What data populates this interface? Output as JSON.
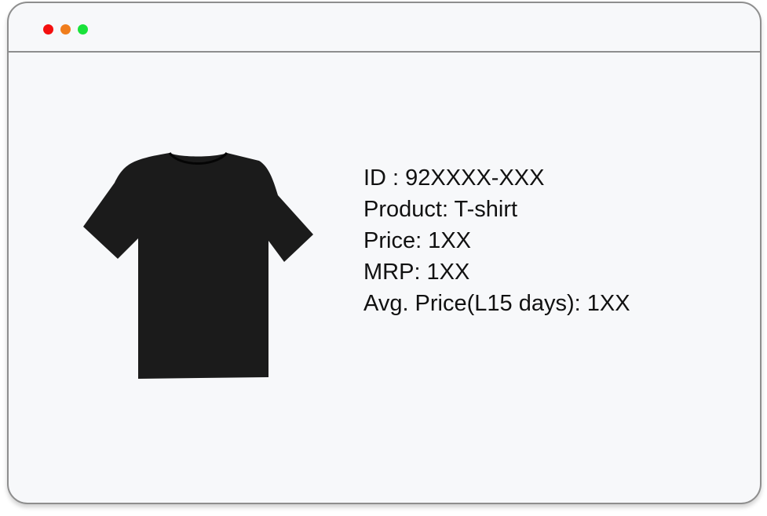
{
  "window": {
    "controls": [
      {
        "name": "close",
        "color": "#f40f0f"
      },
      {
        "name": "minimize",
        "color": "#f07d1c"
      },
      {
        "name": "maximize",
        "color": "#19e23a"
      }
    ]
  },
  "product": {
    "image_icon": "t-shirt-icon",
    "image_color": "#1b1b1b",
    "lines": [
      "ID : 92XXXX-XXX",
      "Product: T-shirt",
      "Price: 1XX",
      "MRP: 1XX",
      "Avg. Price(L15 days): 1XX"
    ]
  }
}
